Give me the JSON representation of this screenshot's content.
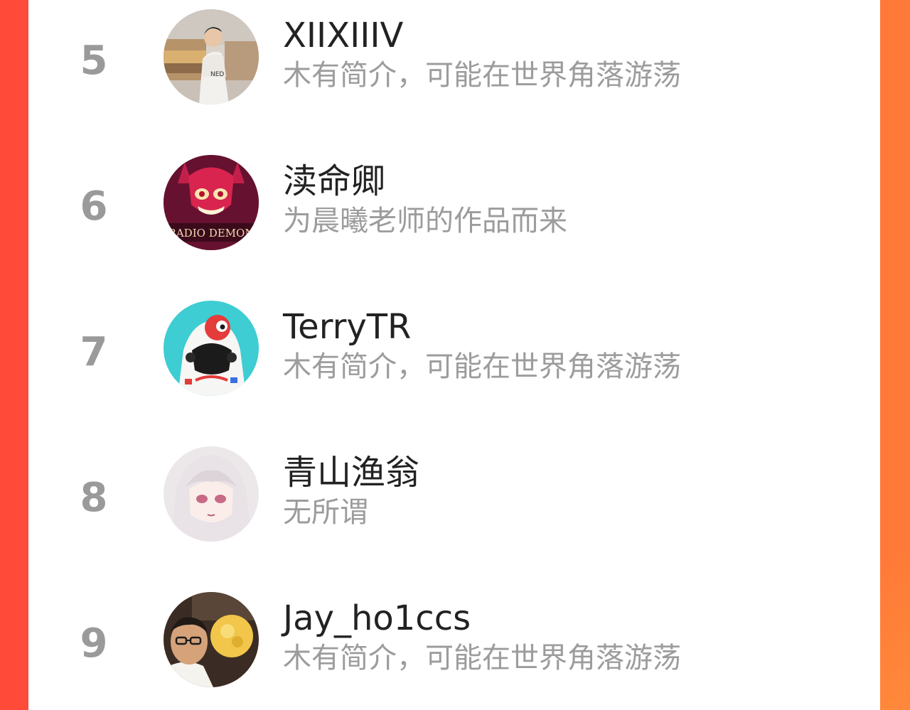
{
  "leaderboard": {
    "entries": [
      {
        "rank": "5",
        "name": "XIIXIIIV",
        "bio": "木有简介，可能在世界角落游荡",
        "avatar_icon": "avatar-man-white-jacket-photo"
      },
      {
        "rank": "6",
        "name": "渎命卿",
        "bio": "为晨曦老师的作品而来",
        "avatar_icon": "avatar-radio-demon-art",
        "avatar_text": "RADIO DEMON"
      },
      {
        "rank": "7",
        "name": "TerryTR",
        "bio": "木有简介，可能在世界角落游荡",
        "avatar_icon": "avatar-hoodie-character-cyan"
      },
      {
        "rank": "8",
        "name": "青山渔翁",
        "bio": "无所谓",
        "avatar_icon": "avatar-anime-girl-white-hair"
      },
      {
        "rank": "9",
        "name": "Jay_ho1ccs",
        "bio": "木有简介，可能在世界角落游荡",
        "avatar_icon": "avatar-man-glasses-selfie"
      }
    ]
  },
  "colors": {
    "frame_left": "#ff4a3a",
    "frame_right": "#ff7a38",
    "rank_text": "#9a9a9a",
    "name_text": "#222222",
    "bio_text": "#9c9c9c"
  }
}
